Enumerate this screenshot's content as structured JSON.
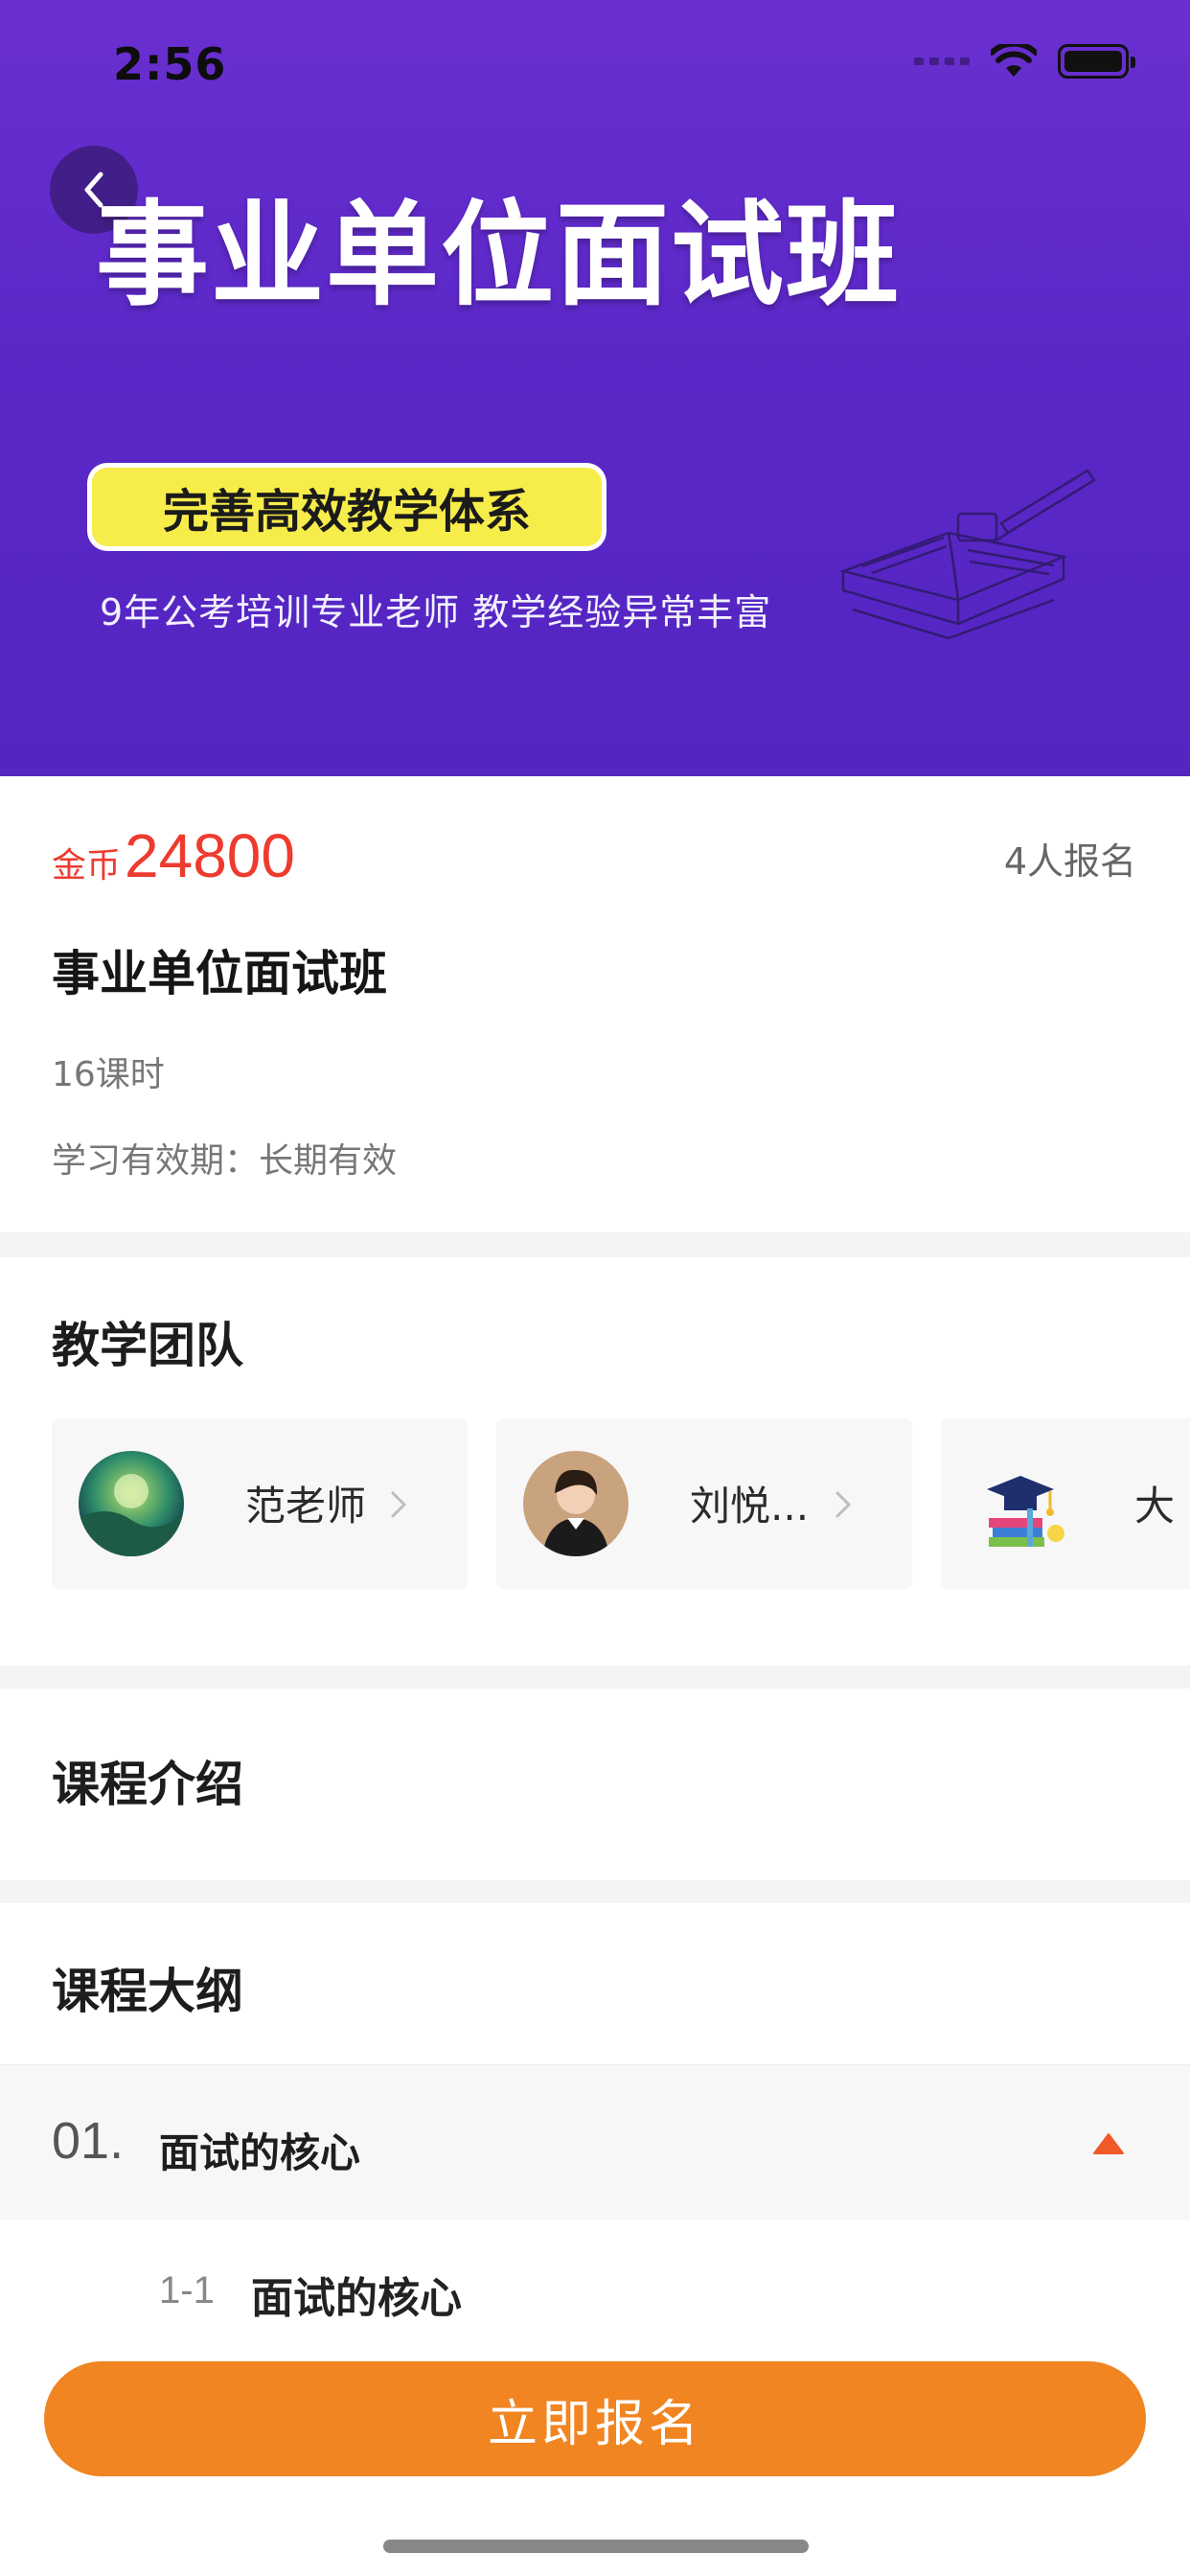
{
  "status_bar": {
    "time": "2:56"
  },
  "banner": {
    "title": "事业单位面试班",
    "pill": "完善高效教学体系",
    "subtitle": "9年公考培训专业老师 教学经验异常丰富"
  },
  "course": {
    "price_unit": "金币",
    "price": "24800",
    "enroll_count": "4人报名",
    "title": "事业单位面试班",
    "hours": "16课时",
    "validity": "学习有效期：长期有效"
  },
  "team": {
    "title": "教学团队",
    "teachers": [
      {
        "name": "范老师"
      },
      {
        "name": "刘悦..."
      },
      {
        "name": "大"
      }
    ]
  },
  "intro": {
    "title": "课程介绍"
  },
  "outline": {
    "title": "课程大纲",
    "chapters": [
      {
        "num": "01.",
        "title": "面试的核心",
        "expanded": true,
        "lessons": [
          {
            "num": "1-1",
            "title": "面试的核心"
          }
        ]
      }
    ]
  },
  "footer": {
    "enroll_button": "立即报名"
  },
  "colors": {
    "accent": "#f08522",
    "price": "#ee3b2f",
    "banner": "#5b28c8",
    "toggle": "#f05a28"
  }
}
